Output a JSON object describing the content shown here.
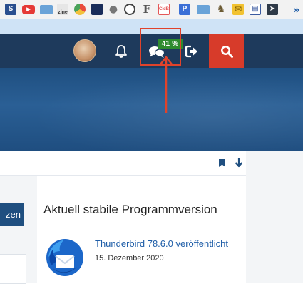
{
  "browser": {
    "bookmarks": [
      {
        "icon": "s-bookmark-icon",
        "label": "S",
        "color": "#2b4f8e"
      },
      {
        "icon": "youtube-icon",
        "label": "▶",
        "color": "#e53935"
      },
      {
        "icon": "folder-icon",
        "label": "",
        "color": "#6aa3d8"
      },
      {
        "icon": "zine-icon",
        "label": "zine",
        "color": "#e6e6e6"
      },
      {
        "icon": "chrome-icon",
        "label": "",
        "color": "#4a8bd6"
      },
      {
        "icon": "windows-icon",
        "label": "",
        "color": "#1a2d5a"
      },
      {
        "icon": "apple-icon",
        "label": "",
        "color": "#777777"
      },
      {
        "icon": "globe-icon",
        "label": "",
        "color": "#444444"
      },
      {
        "icon": "font-icon",
        "label": "F",
        "color": "#555555"
      },
      {
        "icon": "cidb-icon",
        "label": "CidB",
        "color": "#e45757"
      },
      {
        "icon": "p-bookmark-icon",
        "label": "P",
        "color": "#3b6fd6"
      },
      {
        "icon": "folder-icon",
        "label": "",
        "color": "#6aa3d8"
      },
      {
        "icon": "shoe-icon",
        "label": "",
        "color": "#6b5a33"
      },
      {
        "icon": "mail-icon",
        "label": "✉",
        "color": "#f2c230"
      },
      {
        "icon": "newspaper-icon",
        "label": "",
        "color": "#3a5aa0"
      },
      {
        "icon": "arrow-square-icon",
        "label": "",
        "color": "#2f3a48"
      }
    ],
    "overflow": "»"
  },
  "header": {
    "badge": "41 %",
    "avatar_alt": "avatar"
  },
  "widget": {
    "title": "Aktuell stabile Programmversion",
    "news_title": "Thunderbird 78.6.0 veröffentlicht",
    "news_date": "15. Dezember 2020"
  },
  "left_button": {
    "label": "zen"
  },
  "colors": {
    "navbar": "#1e3a5c",
    "hero": "#2a5f95",
    "search_button": "#d73b2a",
    "badge": "#2e8b2e",
    "highlight": "#e0432b",
    "link": "#1f5ea8"
  }
}
